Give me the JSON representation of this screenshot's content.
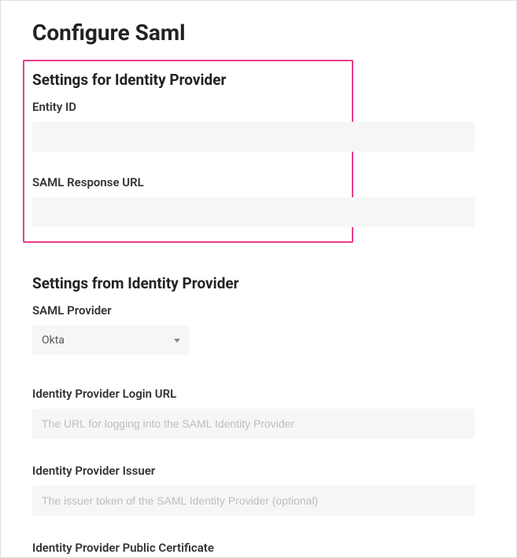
{
  "page": {
    "title": "Configure Saml"
  },
  "settings_for": {
    "heading": "Settings for Identity Provider",
    "entity_id": {
      "label": "Entity ID",
      "value": ""
    },
    "saml_response_url": {
      "label": "SAML Response URL",
      "value": ""
    }
  },
  "settings_from": {
    "heading": "Settings from Identity Provider",
    "saml_provider": {
      "label": "SAML Provider",
      "selected": "Okta"
    },
    "idp_login_url": {
      "label": "Identity Provider Login URL",
      "placeholder": "The URL for logging into the SAML Identity Provider",
      "value": ""
    },
    "idp_issuer": {
      "label": "Identity Provider Issuer",
      "placeholder": "The issuer token of the SAML Identity Provider (optional)",
      "value": ""
    },
    "idp_public_cert": {
      "label": "Identity Provider Public Certificate"
    }
  }
}
